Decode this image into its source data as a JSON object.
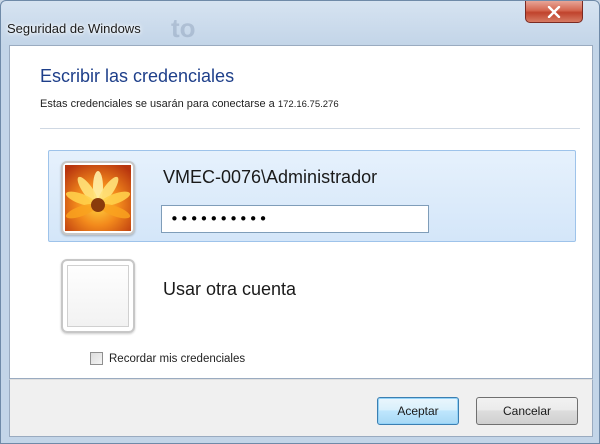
{
  "window": {
    "title": "Seguridad de Windows",
    "close_symbol": "✕"
  },
  "dialog": {
    "heading": "Escribir las credenciales",
    "description_prefix": "Estas credenciales se usarán para conectarse a ",
    "server_address": "172.16.75.276"
  },
  "accounts": {
    "selected": {
      "username": "VMEC-0076\\Administrador",
      "password_masked": "••••••••••",
      "avatar_icon": "flower-avatar-icon"
    },
    "other": {
      "label": "Usar otra cuenta",
      "avatar_icon": "empty-avatar-icon"
    }
  },
  "remember": {
    "label": "Recordar mis credenciales",
    "checked": false
  },
  "buttons": {
    "ok_label": "Aceptar",
    "cancel_label": "Cancelar"
  },
  "colors": {
    "heading": "#1e3f8a",
    "close_button": "#c0432c",
    "selected_tile": "#d4e6f9"
  }
}
